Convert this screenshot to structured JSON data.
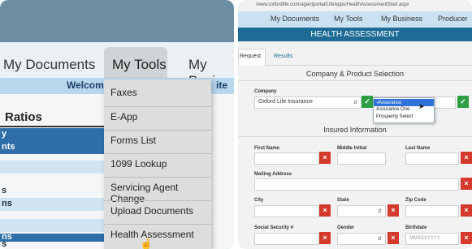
{
  "left_photo": {
    "nav": {
      "my_documents": "My Documents",
      "my_tools": "My Tools",
      "my_business_partial": "My Busin"
    },
    "welcome_partial": "Welcome",
    "welcome_right_partial": "ite",
    "section_heading_partial": "Ratios",
    "background_rows": [
      {
        "label": "y",
        "style": "dark"
      },
      {
        "label": "nts",
        "style": "dark"
      },
      {
        "label": "",
        "style": "light"
      },
      {
        "label": "s",
        "style": "light"
      },
      {
        "label": "ns",
        "style": "light"
      },
      {
        "label": "",
        "style": "light"
      },
      {
        "label": "",
        "style": "light"
      },
      {
        "label": "ns",
        "style": "dark"
      },
      {
        "label": "s",
        "style": "dark"
      }
    ],
    "tools_menu": [
      "Faxes",
      "E-App",
      "Forms List",
      "1099 Lookup",
      "Servicing Agent Change",
      "Upload Documents",
      "Health Assessment"
    ]
  },
  "right_photo": {
    "url": "/www.oxfordlife.com/agentportal/LifeApps/HealthAssessmentStart.aspx",
    "top_nav": {
      "my_documents": "My Documents",
      "my_tools": "My Tools",
      "my_business": "My Business",
      "producer_partial": "Producer"
    },
    "page_title": "HEALTH ASSESSMENT",
    "tabs": {
      "request_partial": "Request",
      "results": "Results"
    },
    "company_section": {
      "heading": "Company & Product Selection",
      "company_label": "Company",
      "company_value": "Oxford Life Insurance",
      "product_options": [
        "Assurance",
        "Assurance One",
        "Prosperity Select"
      ],
      "product_selected": "Assurance"
    },
    "insured_section": {
      "heading": "Insured Information",
      "first_name_label": "First Name",
      "middle_initial_label": "Middle Initial",
      "last_name_label": "Last Name",
      "mailing_address_label": "Mailing Address",
      "city_label": "City",
      "state_label": "State",
      "zip_label": "Zip Code",
      "ssn_label": "Social Security #",
      "gender_label": "Gender",
      "birthdate_label": "Birthdate",
      "birthdate_placeholder": "MM/DD/YYYY"
    },
    "colors": {
      "title_bar": "#1e6c95",
      "error": "#d33a2c",
      "valid": "#2e9e44"
    }
  }
}
